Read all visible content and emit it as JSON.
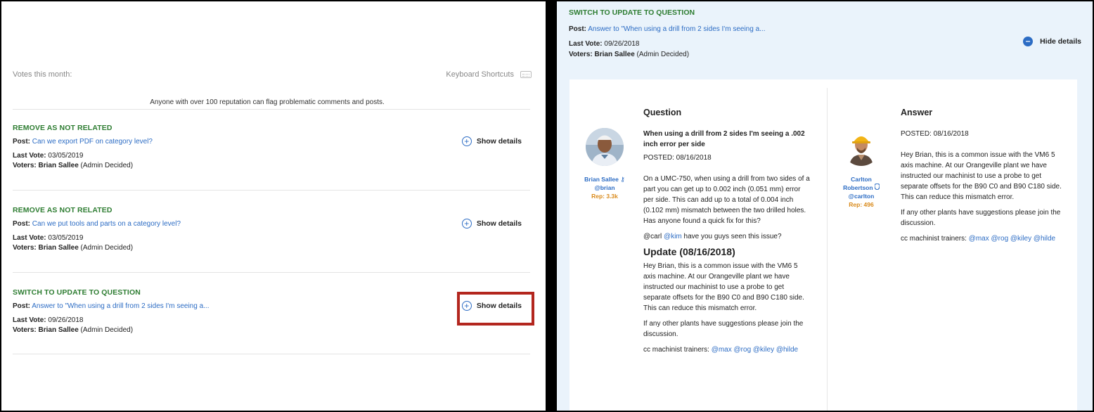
{
  "left": {
    "votes_label": "Votes this month:",
    "shortcuts_label": "Keyboard Shortcuts",
    "flag_note": "Anyone with over 100 reputation can flag problematic comments and posts.",
    "items": [
      {
        "type": "REMOVE AS NOT RELATED",
        "post_prefix": "Post:",
        "post_link": "Can we export PDF on category level?",
        "vote_prefix": "Last Vote:",
        "vote_date": "03/05/2019",
        "voters_prefix": "Voters:",
        "voter_name": "Brian Sallee",
        "voter_note": "(Admin Decided)",
        "button_label": "Show details"
      },
      {
        "type": "REMOVE AS NOT RELATED",
        "post_prefix": "Post:",
        "post_link": "Can we put tools and parts on a category level?",
        "vote_prefix": "Last Vote:",
        "vote_date": "03/05/2019",
        "voters_prefix": "Voters:",
        "voter_name": "Brian Sallee",
        "voter_note": "(Admin Decided)",
        "button_label": "Show details"
      },
      {
        "type": "SWITCH TO UPDATE TO QUESTION",
        "post_prefix": "Post:",
        "post_link": "Answer to \"When using a drill from 2 sides I'm seeing a...",
        "vote_prefix": "Last Vote:",
        "vote_date": "09/26/2018",
        "voters_prefix": "Voters:",
        "voter_name": "Brian Sallee",
        "voter_note": "(Admin Decided)",
        "button_label": "Show details"
      }
    ]
  },
  "right": {
    "type": "SWITCH TO UPDATE TO QUESTION",
    "post_prefix": "Post:",
    "post_link": "Answer to \"When using a drill from 2 sides I'm seeing a...",
    "vote_prefix": "Last Vote:",
    "vote_date": "09/26/2018",
    "voters_prefix": "Voters:",
    "voter_name": "Brian Sallee",
    "voter_note": "(Admin Decided)",
    "hide_label": "Hide details",
    "question": {
      "heading": "Question",
      "author_name": "Brian Sallee",
      "author_handle": "@brian",
      "author_rep": "Rep: 3.3k",
      "title": "When using a drill from 2 sides I'm seeing a .002 inch error per side",
      "posted": "POSTED: 08/16/2018",
      "body": "On a UMC-750, when using a drill from two sides of a part you can get up to 0.002 inch (0.051 mm) error per side. This can add up to a total of 0.004 inch (0.102 mm) mismatch between the two drilled holes. Has anyone found a quick fix for this?",
      "mention_prefix": "@carl",
      "mention_link": "@kim",
      "mention_suffix": "have you guys seen this issue?",
      "update_heading": "Update (08/16/2018)",
      "update_body": "Hey Brian, this is a common issue with the VM6 5 axis machine. At our Orangeville plant we have instructed our machinist to use a probe to get separate offsets for the B90 C0 and B90 C180 side.  This can reduce this mismatch error.",
      "update_join": "If any other plants have suggestions please join the discussion.",
      "cc_prefix": "cc machinist trainers:",
      "cc_links": "@max @rog @kiley @hilde"
    },
    "answer": {
      "heading": "Answer",
      "author_first": "Carlton",
      "author_last": "Robertson",
      "author_handle": "@carlton",
      "author_rep": "Rep: 496",
      "posted": "POSTED: 08/16/2018",
      "body": "Hey Brian, this is a common issue with the VM6 5 axis machine. At our Orangeville plant we have instructed our machinist to use a probe to get separate offsets for the B90 C0 and B90 C180 side.  This can reduce this mismatch error.",
      "join": "If any other plants have suggestions please join the discussion.",
      "cc_prefix": "cc machinist trainers:",
      "cc_links": "@max @rog @kiley @hilde"
    }
  }
}
